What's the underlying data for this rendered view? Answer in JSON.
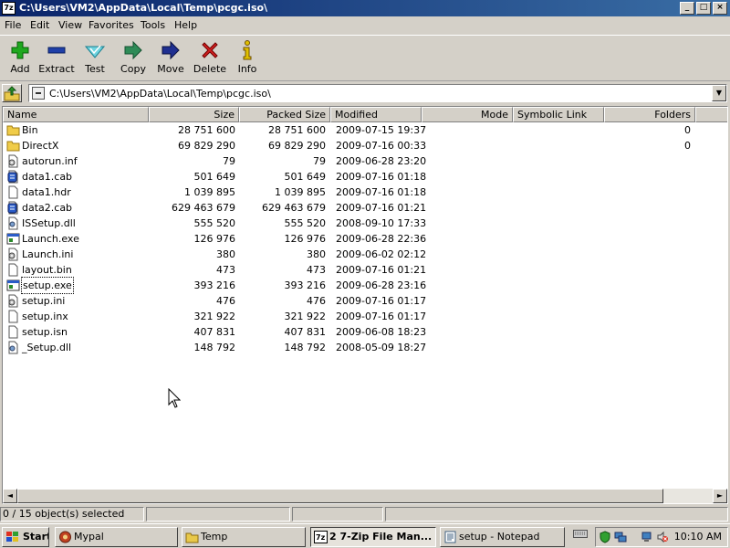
{
  "window": {
    "app_icon": "7z",
    "title": "C:\\Users\\VM2\\AppData\\Local\\Temp\\pcgc.iso\\",
    "controls": {
      "minimize": "_",
      "maximize": "□",
      "close": "×"
    }
  },
  "menu": [
    "File",
    "Edit",
    "View",
    "Favorites",
    "Tools",
    "Help"
  ],
  "toolbar": [
    {
      "label": "Add",
      "icon": "plus-icon",
      "color": "#1fa81f"
    },
    {
      "label": "Extract",
      "icon": "minus-icon",
      "color": "#1f3fa8"
    },
    {
      "label": "Test",
      "icon": "checkmark-icon",
      "color": "#2bb0c0"
    },
    {
      "label": "Copy",
      "icon": "copy-arrow-icon",
      "color": "#2e8b57"
    },
    {
      "label": "Move",
      "icon": "move-arrow-icon",
      "color": "#1f3fa8"
    },
    {
      "label": "Delete",
      "icon": "delete-x-icon",
      "color": "#d02020"
    },
    {
      "label": "Info",
      "icon": "info-icon",
      "color": "#e0c000"
    }
  ],
  "address": {
    "path": "C:\\Users\\VM2\\AppData\\Local\\Temp\\pcgc.iso\\",
    "dropdown": "▼"
  },
  "columns": [
    "Name",
    "Size",
    "Packed Size",
    "Modified",
    "Mode",
    "Symbolic Link",
    "Folders"
  ],
  "files": [
    {
      "name": "Bin",
      "size": "28 751 600",
      "packed": "28 751 600",
      "modified": "2009-07-15 19:37",
      "folders": "0",
      "icon": "folder-icon"
    },
    {
      "name": "DirectX",
      "size": "69 829 290",
      "packed": "69 829 290",
      "modified": "2009-07-16 00:33",
      "folders": "0",
      "icon": "folder-icon"
    },
    {
      "name": "autorun.inf",
      "size": "79",
      "packed": "79",
      "modified": "2009-06-28 23:20",
      "folders": "",
      "icon": "settings-file-icon"
    },
    {
      "name": "data1.cab",
      "size": "501 649",
      "packed": "501 649",
      "modified": "2009-07-16 01:18",
      "folders": "",
      "icon": "cab-file-icon"
    },
    {
      "name": "data1.hdr",
      "size": "1 039 895",
      "packed": "1 039 895",
      "modified": "2009-07-16 01:18",
      "folders": "",
      "icon": "blank-file-icon"
    },
    {
      "name": "data2.cab",
      "size": "629 463 679",
      "packed": "629 463 679",
      "modified": "2009-07-16 01:21",
      "folders": "",
      "icon": "cab-file-icon"
    },
    {
      "name": "ISSetup.dll",
      "size": "555 520",
      "packed": "555 520",
      "modified": "2008-09-10 17:33",
      "folders": "",
      "icon": "dll-file-icon"
    },
    {
      "name": "Launch.exe",
      "size": "126 976",
      "packed": "126 976",
      "modified": "2009-06-28 22:36",
      "folders": "",
      "icon": "exe-file-icon"
    },
    {
      "name": "Launch.ini",
      "size": "380",
      "packed": "380",
      "modified": "2009-06-02 02:12",
      "folders": "",
      "icon": "settings-file-icon"
    },
    {
      "name": "layout.bin",
      "size": "473",
      "packed": "473",
      "modified": "2009-07-16 01:21",
      "folders": "",
      "icon": "blank-file-icon"
    },
    {
      "name": "setup.exe",
      "size": "393 216",
      "packed": "393 216",
      "modified": "2009-06-28 23:16",
      "folders": "",
      "icon": "exe-file-icon"
    },
    {
      "name": "setup.ini",
      "size": "476",
      "packed": "476",
      "modified": "2009-07-16 01:17",
      "folders": "",
      "icon": "settings-file-icon"
    },
    {
      "name": "setup.inx",
      "size": "321 922",
      "packed": "321 922",
      "modified": "2009-07-16 01:17",
      "folders": "",
      "icon": "blank-file-icon"
    },
    {
      "name": "setup.isn",
      "size": "407 831",
      "packed": "407 831",
      "modified": "2009-06-08 18:23",
      "folders": "",
      "icon": "blank-file-icon"
    },
    {
      "name": "_Setup.dll",
      "size": "148 792",
      "packed": "148 792",
      "modified": "2008-05-09 18:27",
      "folders": "",
      "icon": "dll-file-icon"
    }
  ],
  "scroll": {
    "left": "◄",
    "right": "►"
  },
  "status": {
    "selection": "0 / 15 object(s) selected"
  },
  "taskbar": {
    "start": "Start",
    "items": [
      "Mypal",
      "Temp",
      "2 7-Zip File Man...",
      "setup - Notepad"
    ],
    "clock": "10:10 AM"
  }
}
